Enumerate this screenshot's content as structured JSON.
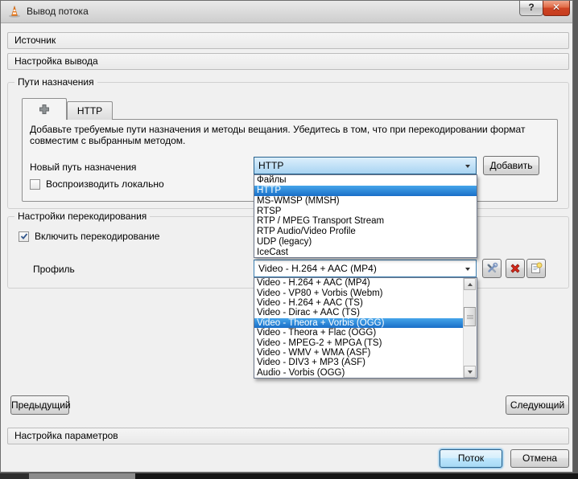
{
  "window": {
    "title": "Вывод потока",
    "help_glyph": "?",
    "close_glyph": "✕"
  },
  "sections": {
    "source": "Источник",
    "output": "Настройка вывода",
    "params": "Настройка параметров"
  },
  "destinations": {
    "group_title": "Пути назначения",
    "tab_http_label": "HTTP",
    "description": "Добавьте требуемые пути назначения и методы вещания. Убедитесь в том, что при перекодировании формат совместим с выбранным методом.",
    "new_dest_label": "Новый путь назначения",
    "method_value": "HTTP",
    "add_button": "Добавить",
    "play_locally_label": "Воспроизводить локально",
    "play_locally_checked": false,
    "method_options": [
      "Файлы",
      "HTTP",
      "MS-WMSP (MMSH)",
      "RTSP",
      "RTP / MPEG Transport Stream",
      "RTP Audio/Video Profile",
      "UDP (legacy)",
      "IceCast"
    ],
    "method_highlight_index": 1
  },
  "transcoding": {
    "group_title": "Настройки перекодирования",
    "enable_label": "Включить перекодирование",
    "enable_checked": true,
    "profile_label": "Профиль",
    "profile_value": "Video - H.264 + AAC (MP4)",
    "profile_options": [
      "Video - H.264 + AAC (MP4)",
      "Video - VP80 + Vorbis (Webm)",
      "Video - H.264 + AAC (TS)",
      "Video - Dirac + AAC (TS)",
      "Video - Theora + Vorbis (OGG)",
      "Video - Theora + Flac (OGG)",
      "Video - MPEG-2 + MPGA (TS)",
      "Video - WMV + WMA (ASF)",
      "Video - DIV3 + MP3 (ASF)",
      "Audio - Vorbis (OGG)"
    ],
    "profile_highlight_index": 4
  },
  "nav": {
    "prev": "Предыдущий",
    "next": "Следующий"
  },
  "footer": {
    "stream": "Поток",
    "cancel": "Отмена"
  },
  "icons": {
    "app": "vlc-cone-icon",
    "add_tab": "plus-icon",
    "profile_edit": "tools-icon",
    "profile_delete": "delete-x-icon",
    "profile_info": "document-info-icon"
  },
  "colors": {
    "selection_blue_top": "#45a5ea",
    "selection_blue_bottom": "#1a6fc8",
    "focus_border": "#3c7fb1",
    "close_button_red": "#cf4524",
    "default_button_glow": "#6ab6e8"
  }
}
